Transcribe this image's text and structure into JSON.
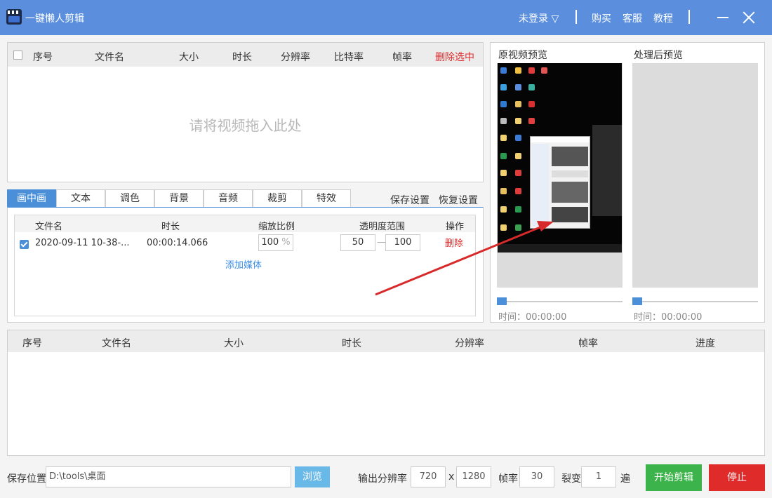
{
  "titlebar": {
    "app_name": "一键懒人剪辑",
    "login": "未登录 ▽",
    "buy": "购买",
    "service": "客服",
    "tutorial": "教程"
  },
  "input_table": {
    "headers": [
      "序号",
      "文件名",
      "大小",
      "时长",
      "分辨率",
      "比特率",
      "帧率"
    ],
    "delete_selected": "删除选中",
    "drop_hint": "请将视频拖入此处"
  },
  "tabs": [
    "画中画",
    "文本",
    "调色",
    "背景",
    "音频",
    "裁剪",
    "特效"
  ],
  "active_tab": 0,
  "save_settings": "保存设置",
  "restore_settings": "恢复设置",
  "pip": {
    "headers": {
      "filename": "文件名",
      "duration": "时长",
      "scale": "缩放比例",
      "opacity": "透明度范围",
      "action": "操作"
    },
    "rows": [
      {
        "checked": true,
        "filename": "2020-09-11 10-38-...",
        "duration": "00:00:14.066",
        "scale": "100",
        "scale_unit": "%",
        "opacity_from": "50",
        "opacity_sep": "—",
        "opacity_to": "100",
        "action": "删除"
      }
    ],
    "add_media": "添加媒体"
  },
  "preview": {
    "original_title": "原视频预览",
    "processed_title": "处理后预览",
    "original_time": "时间：00:00:00",
    "processed_time": "时间：00:00:00"
  },
  "output_table": {
    "headers": [
      "序号",
      "文件名",
      "大小",
      "时长",
      "分辨率",
      "帧率",
      "进度"
    ]
  },
  "bottom": {
    "save_location_label": "保存位置",
    "save_path": "D:\\tools\\桌面",
    "browse": "浏览",
    "output_resolution_label": "输出分辨率",
    "width": "720",
    "x_sep": "x",
    "height": "1280",
    "fps_label": "帧率",
    "fps": "30",
    "split_label": "裂变",
    "split": "1",
    "split_unit": "遍",
    "start": "开始剪辑",
    "stop": "停止"
  },
  "colors": {
    "titlebar": "#5b8fdd",
    "accent": "#4a8fd8",
    "start_button": "#3cb44b",
    "stop_button": "#e02b2b",
    "delete_text": "#e02b2b"
  }
}
